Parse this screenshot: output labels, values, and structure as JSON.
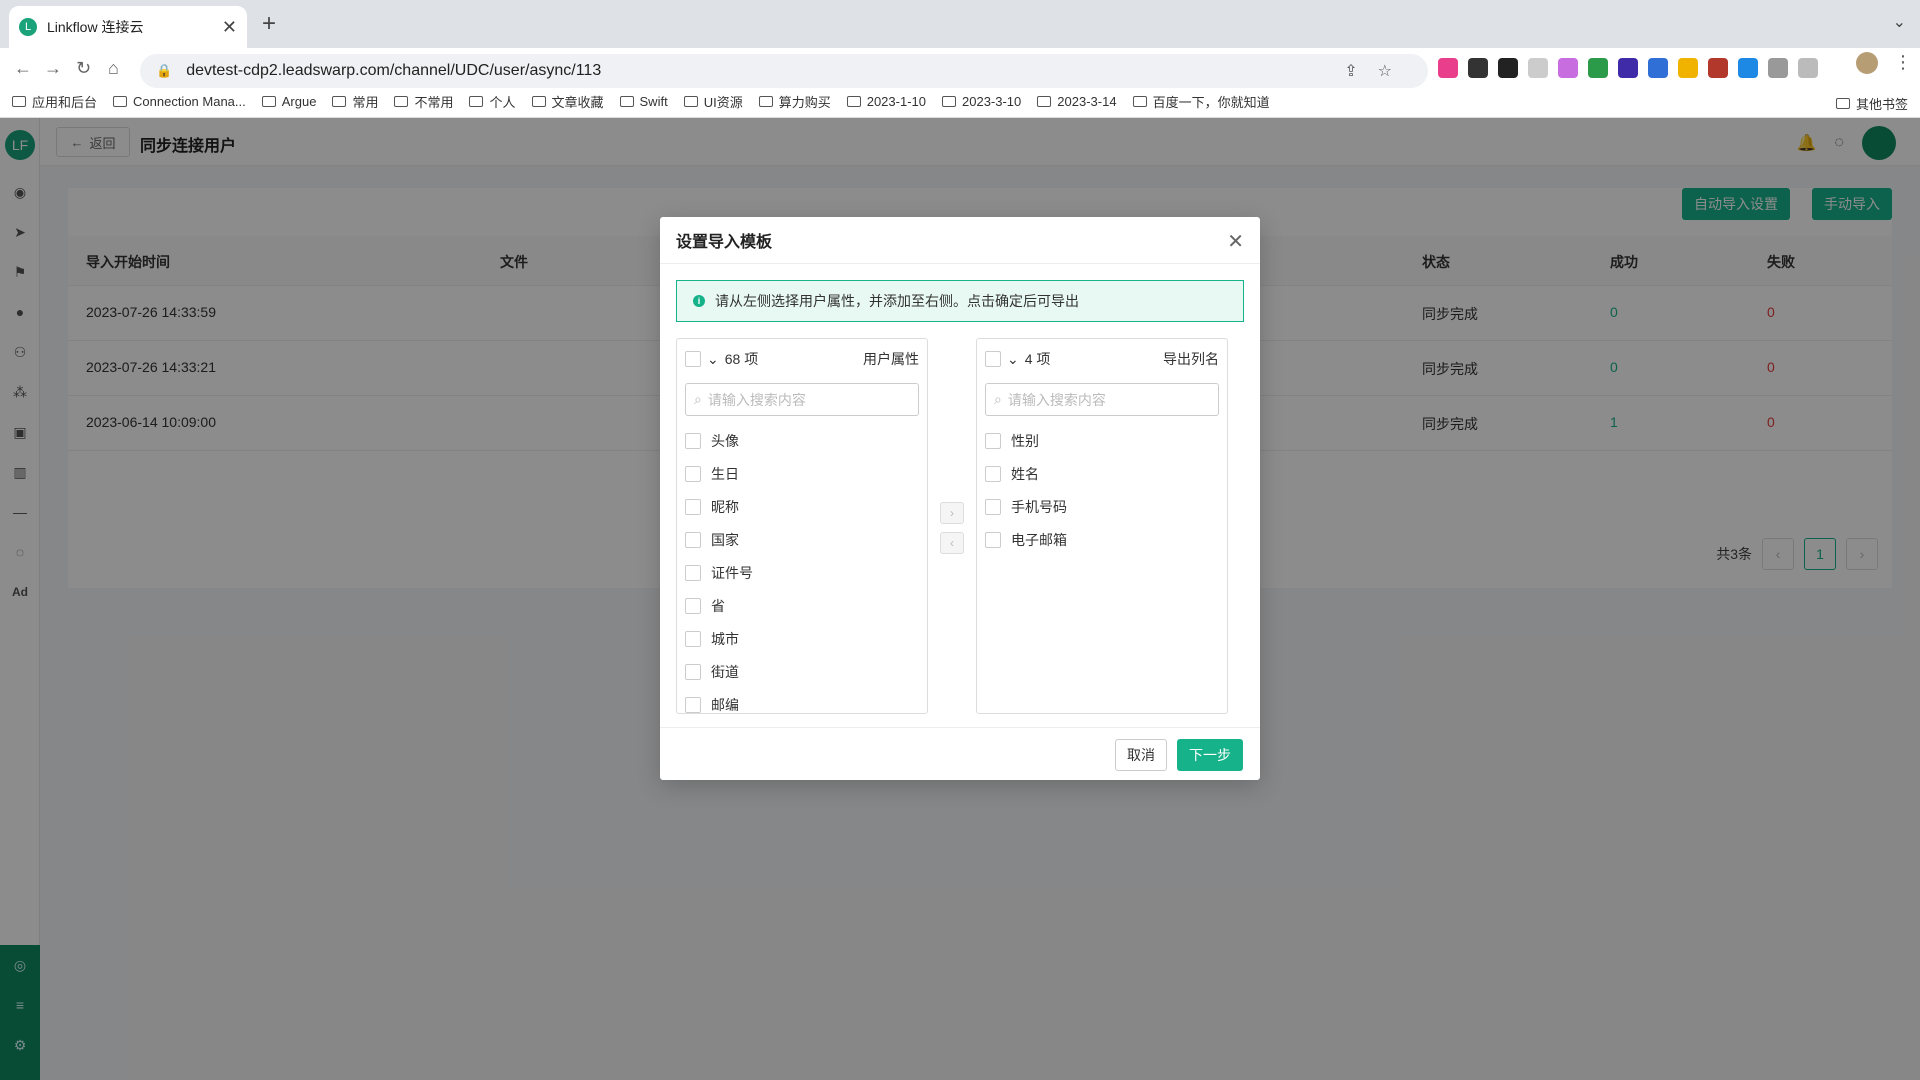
{
  "browser": {
    "tab_title": "Linkflow 连接云",
    "url": "devtest-cdp2.leadswarp.com/channel/UDC/user/async/113",
    "bookmarks": [
      "应用和后台",
      "Connection Mana...",
      "Argue",
      "常用",
      "不常用",
      "个人",
      "文章收藏",
      "Swift",
      "UI资源",
      "算力购买",
      "2023-1-10",
      "2023-3-10",
      "2023-3-14",
      "百度一下，你就知道"
    ],
    "other_bookmarks": "其他书签"
  },
  "header": {
    "back_label": "返回",
    "title": "同步连接用户"
  },
  "toolbar": {
    "auto_import": "自动导入设置",
    "manual_import": "手动导入"
  },
  "table": {
    "columns": [
      "导入开始时间",
      "文件",
      "状态",
      "成功",
      "失败"
    ],
    "rows": [
      {
        "time": "2023-07-26 14:33:59",
        "status": "同步完成",
        "success": "0",
        "fail": "0"
      },
      {
        "time": "2023-07-26 14:33:21",
        "status": "同步完成",
        "success": "0",
        "fail": "0"
      },
      {
        "time": "2023-06-14 10:09:00",
        "status": "同步完成",
        "success": "1",
        "fail": "0"
      }
    ],
    "total": "共3条",
    "page": "1"
  },
  "modal": {
    "title": "设置导入模板",
    "alert": "请从左侧选择用户属性，并添加至右侧。点击确定后可导出",
    "left": {
      "count": "68 项",
      "title": "用户属性",
      "placeholder": "请输入搜索内容",
      "items": [
        "头像",
        "生日",
        "昵称",
        "国家",
        "证件号",
        "省",
        "城市",
        "街道",
        "邮编"
      ]
    },
    "right": {
      "count": "4 项",
      "title": "导出列名",
      "placeholder": "请输入搜索内容",
      "items": [
        "性别",
        "姓名",
        "手机号码",
        "电子邮箱"
      ]
    },
    "cancel": "取消",
    "next": "下一步"
  },
  "colors": {
    "accent": "#16b28a",
    "danger": "#e63b3b"
  }
}
